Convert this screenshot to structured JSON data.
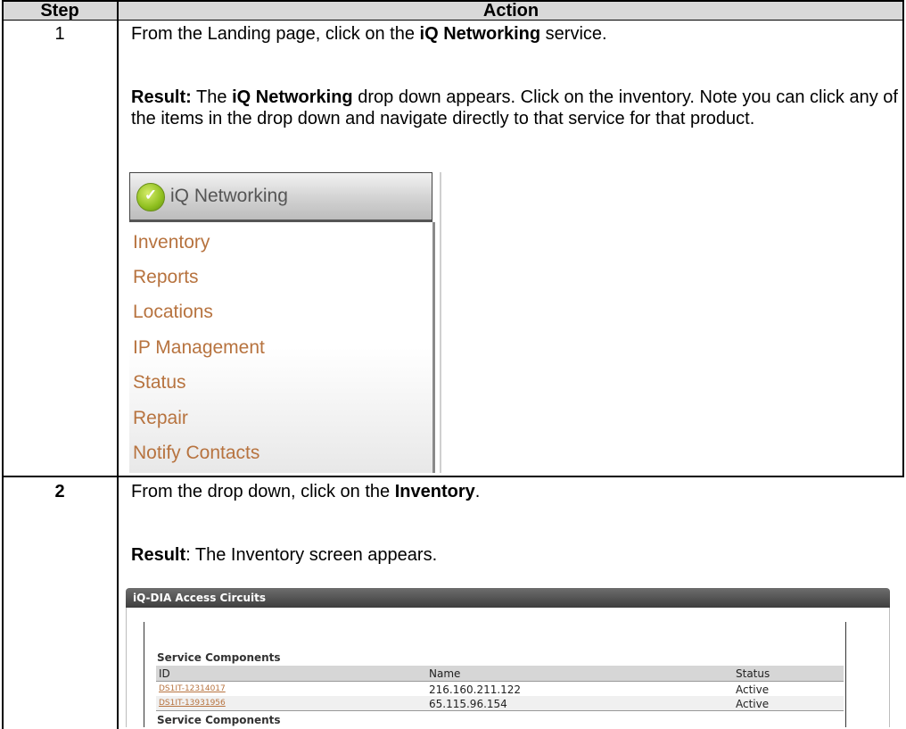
{
  "table": {
    "headers": {
      "step": "Step",
      "action": "Action"
    },
    "rows": [
      {
        "step": "1",
        "instruction_pre": "From the Landing page, click on the ",
        "instruction_bold": "iQ Networking",
        "instruction_post": " service.",
        "result_label": "Result:",
        "result_pre": " The ",
        "result_bold": "iQ Networking",
        "result_post": " drop down appears.  Click on the inventory. Note you can click any of the items in the drop down and navigate directly to that service for that product."
      },
      {
        "step": "2",
        "instruction_pre": "From the drop down, click on the ",
        "instruction_bold": "Inventory",
        "instruction_post": ".",
        "result_label": "Result",
        "result_post": ":  The Inventory screen appears."
      }
    ]
  },
  "dropdown": {
    "title": "iQ Networking",
    "logo_icon": "checkmark-circle-icon",
    "items": [
      "Inventory",
      "Reports",
      "Locations",
      "IP Management",
      "Status",
      "Repair",
      "Notify Contacts"
    ]
  },
  "inventory_panel": {
    "title": "iQ-DIA Access Circuits",
    "section_label": "Service Components",
    "columns": [
      "ID",
      "Name",
      "Status"
    ],
    "rows": [
      {
        "id": "DS1IT-12314017",
        "name": "216.160.211.122",
        "status": "Active"
      },
      {
        "id": "DS1IT-13931956",
        "name": "65.115.96.154",
        "status": "Active"
      }
    ],
    "footer_label": "Service Components"
  },
  "colors": {
    "link": "#b7733f",
    "header_bg": "#d9d9d9"
  }
}
